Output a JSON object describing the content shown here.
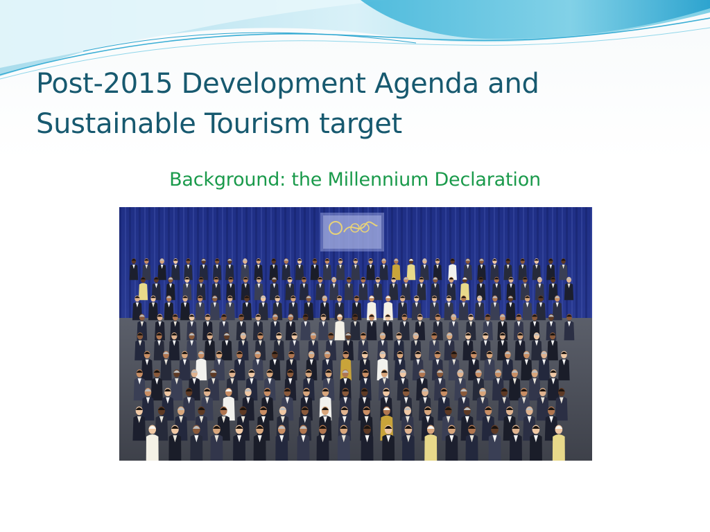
{
  "slide": {
    "title_line1": "Post-2015 Development Agenda and",
    "title_line2": "Sustainable Tourism target",
    "subtitle": "Background: the Millennium Declaration"
  },
  "photo": {
    "subject": "group-photo",
    "backdrop_emblem": "un-millennium-summit-emblem"
  },
  "colors": {
    "title": "#17596f",
    "subtitle": "#1a9a4b",
    "wave_light": "#bfe7f2",
    "wave_mid": "#5ec4e0",
    "wave_dark": "#2aa4cf",
    "curtain": "#2a3b8f"
  }
}
